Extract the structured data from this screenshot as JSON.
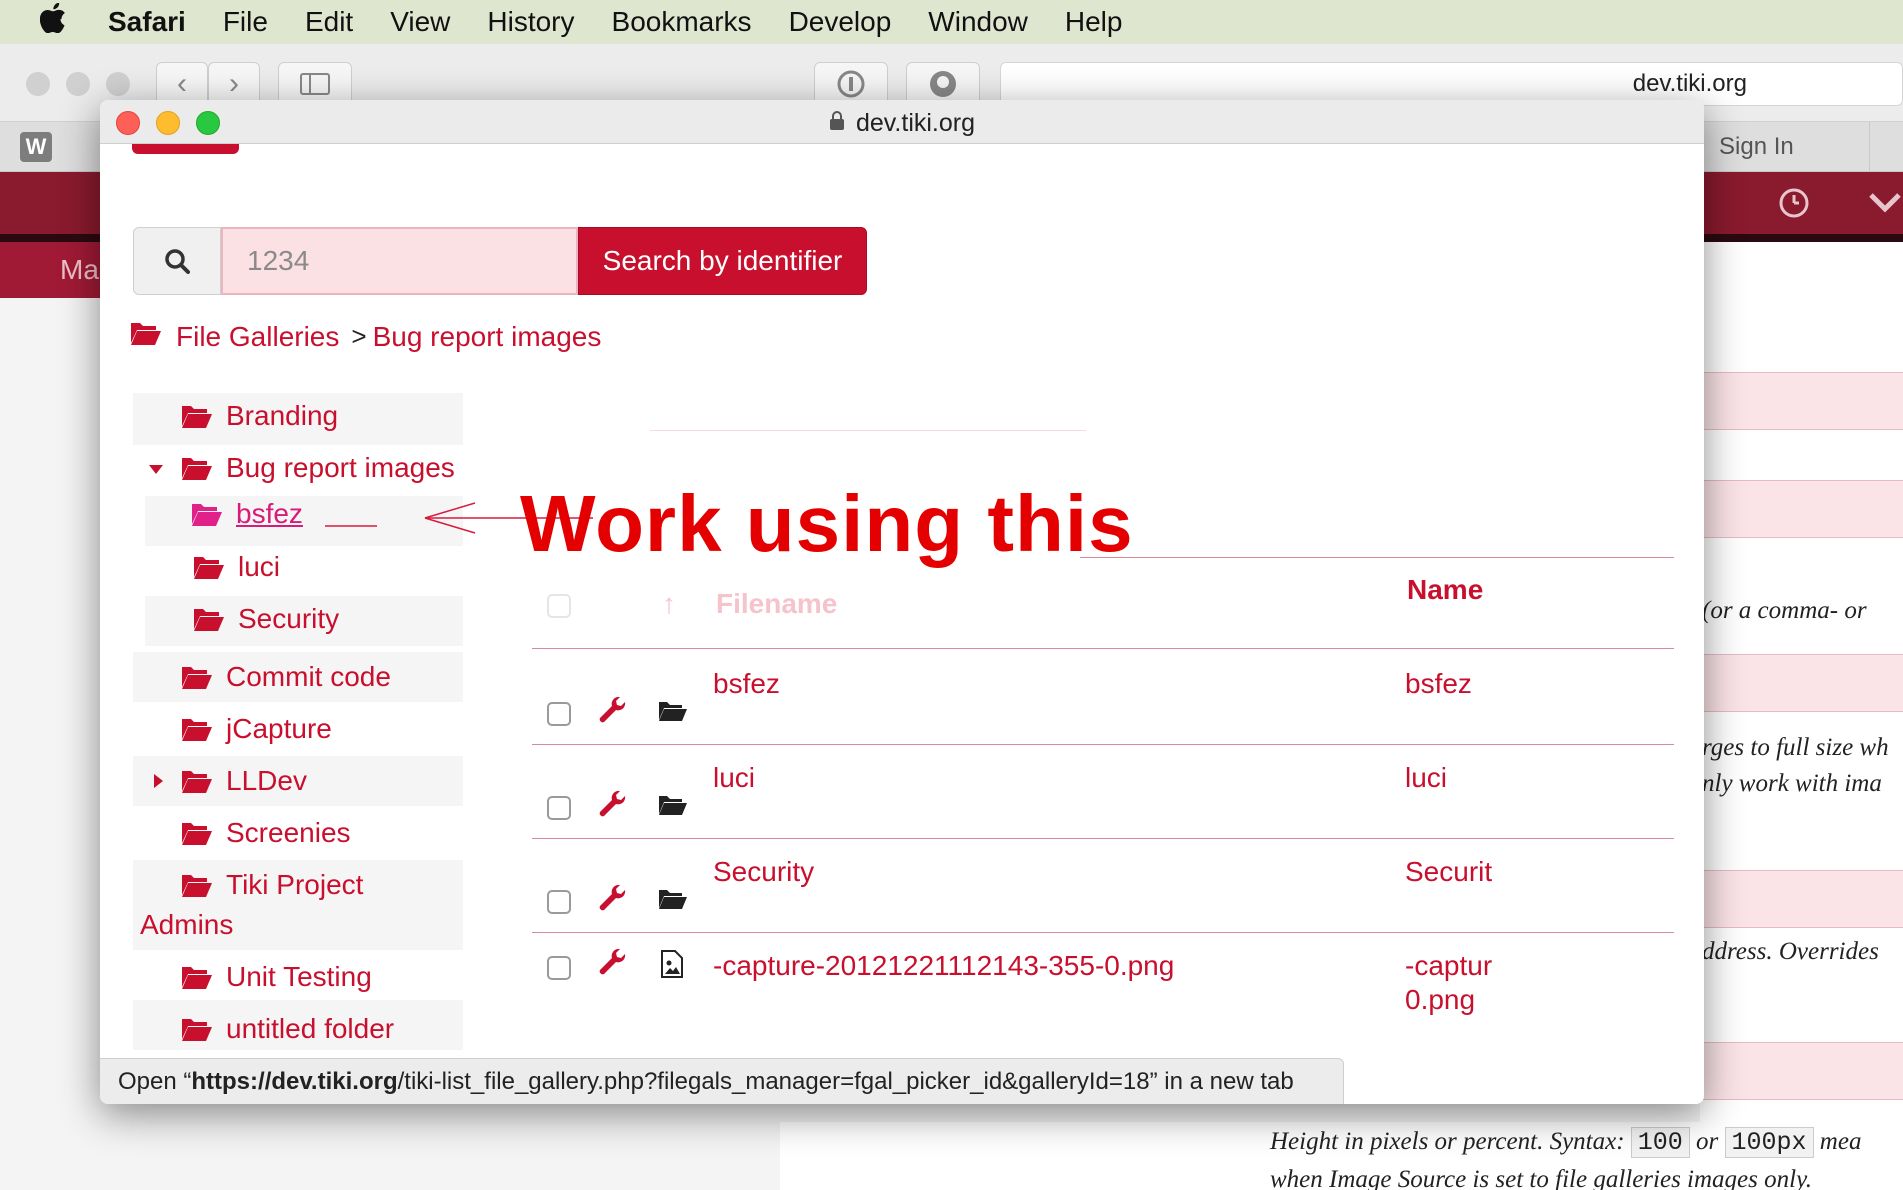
{
  "menubar": {
    "app": "Safari",
    "items": [
      "File",
      "Edit",
      "View",
      "History",
      "Bookmarks",
      "Develop",
      "Window",
      "Help"
    ]
  },
  "background": {
    "url": "dev.tiki.org",
    "sign_in": "Sign In",
    "sub_tab": "Ma",
    "hints": [
      "(or a comma- or",
      "rges to full size wh",
      "nly work with ima",
      "ddress. Overrides"
    ],
    "height_hint_prefix": "Height in pixels or percent. Syntax:",
    "code1": "100",
    "or": "or",
    "code2": "100px",
    "hint_suffix": "mea",
    "line2": "when Image Source is set to file galleries images only."
  },
  "popup": {
    "url": "dev.tiki.org",
    "search": {
      "placeholder": "1234",
      "button": "Search by identifier"
    },
    "breadcrumb": {
      "root": "File Galleries",
      "sep": ">",
      "current": "Bug report images"
    },
    "tree": {
      "branding": "Branding",
      "bug_report": "Bug report images",
      "bsfez": "bsfez",
      "luci": "luci",
      "security": "Security",
      "commit": "Commit code",
      "jcapture": "jCapture",
      "lldev": "LLDev",
      "screenies": "Screenies",
      "tiki1": "Tiki Project",
      "tiki2": "Admins",
      "unit": "Unit Testing",
      "untitled": "untitled folder"
    },
    "annotation": "Work using this",
    "table": {
      "header_filename": "Filename",
      "header_name": "Name",
      "rows": [
        {
          "filename": "bsfez",
          "name": "bsfez"
        },
        {
          "filename": "luci",
          "name": "luci"
        },
        {
          "filename": "Security",
          "name": "Securit"
        },
        {
          "filename": "-capture-20121221112143-355-0.png",
          "name": "-captur",
          "name2": "0.png"
        }
      ]
    },
    "status": {
      "prefix": "Open “",
      "host": "https://dev.tiki.org",
      "path": "/tiki-list_file_gallery.php?filegals_manager=fgal_picker_id&galleryId=18",
      "suffix": "” in a new tab"
    }
  },
  "colors": {
    "accent": "#c8102e",
    "annotation": "#e40000",
    "navbar": "#8a1a2e"
  }
}
